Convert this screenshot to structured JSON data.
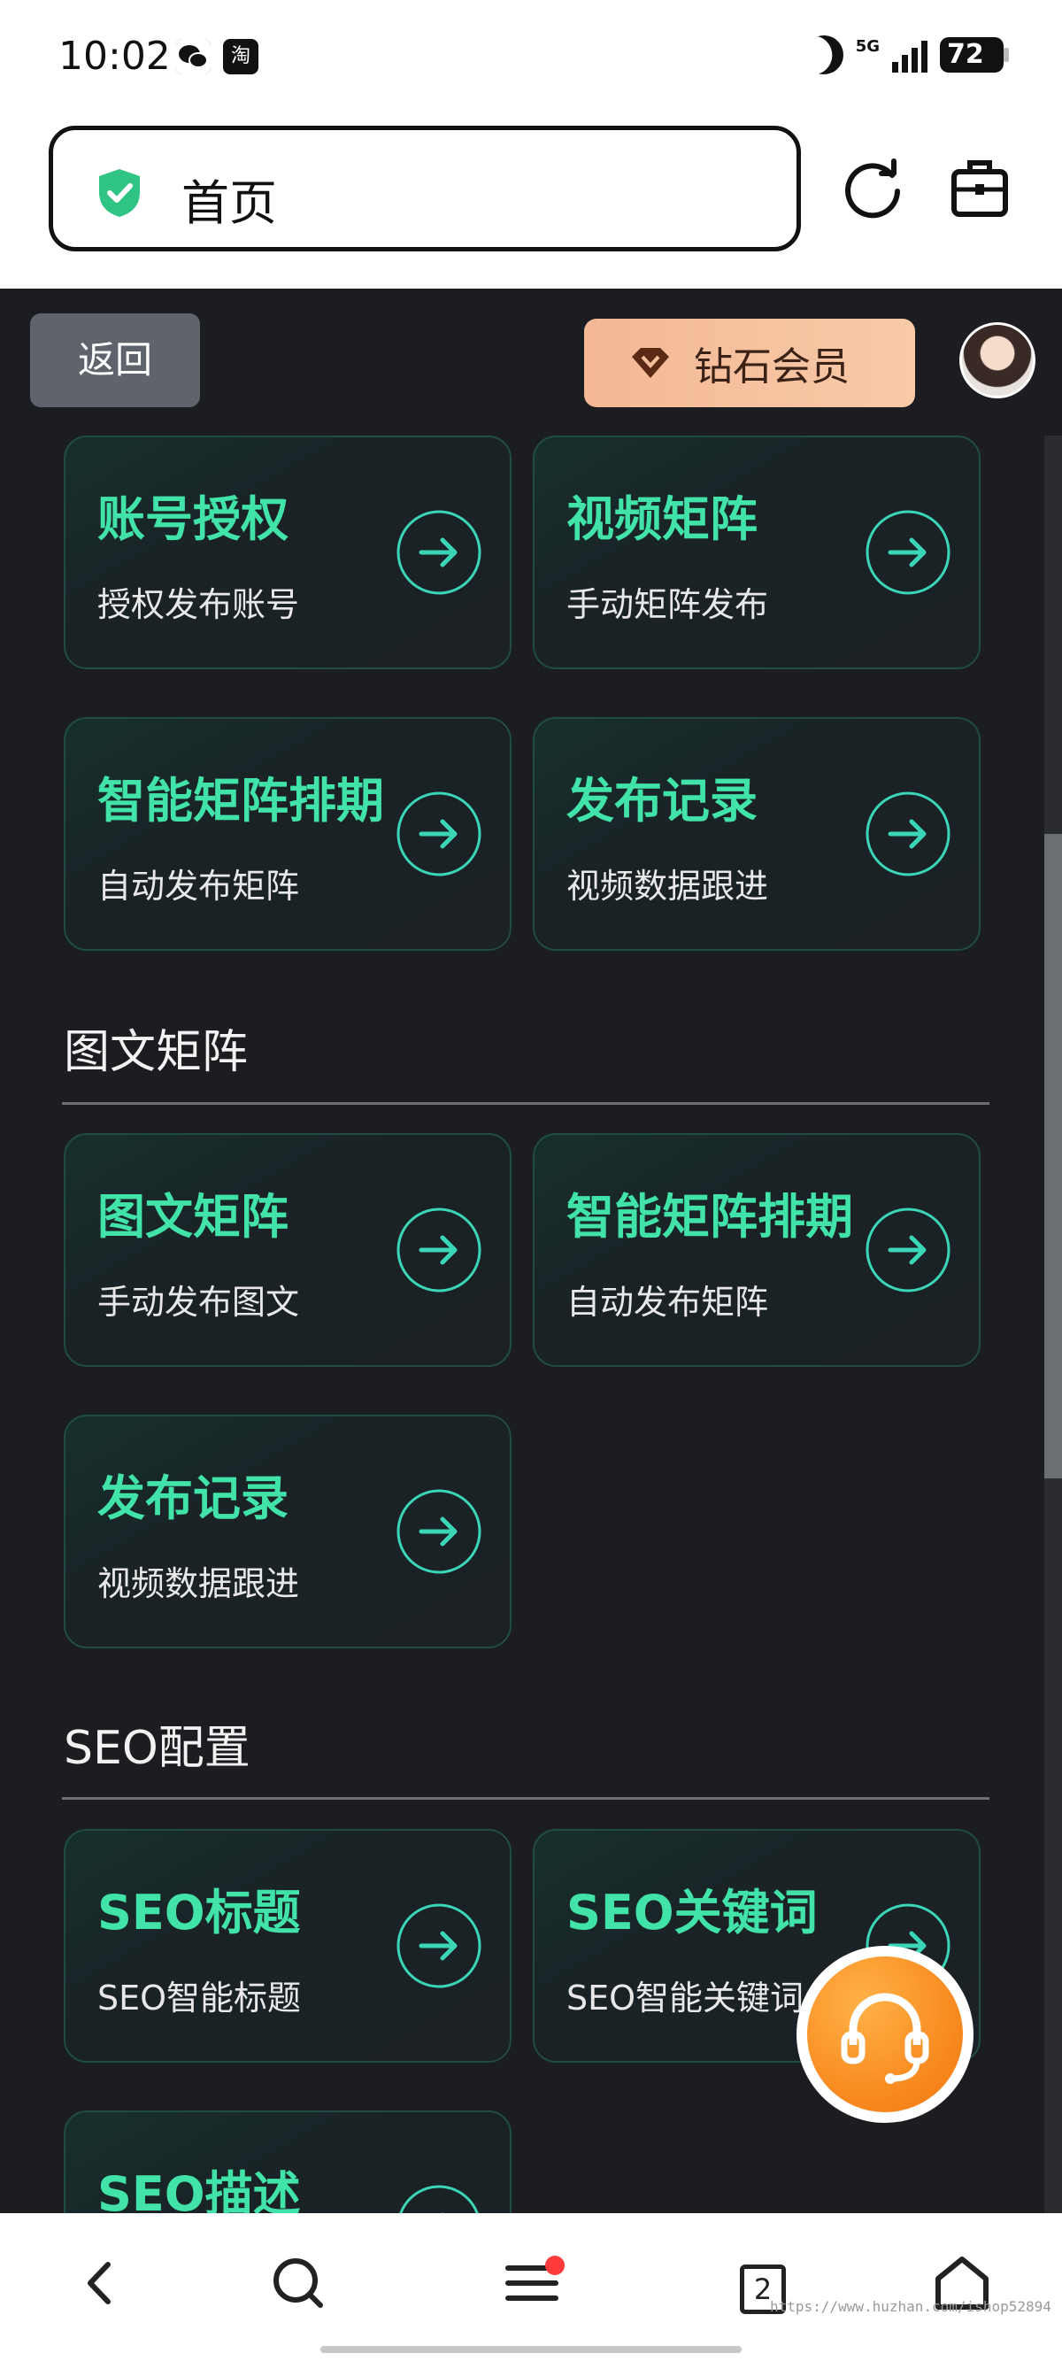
{
  "status_bar": {
    "time": "10:02",
    "app_icons": [
      "wechat-icon",
      "taobao-icon"
    ],
    "taobao_label": "淘",
    "network": "5G",
    "battery": "72"
  },
  "address_bar": {
    "title": "首页"
  },
  "header": {
    "back_label": "返回",
    "vip_label": "钻石会员"
  },
  "cards_top": [
    {
      "title": "账号授权",
      "subtitle": "授权发布账号"
    },
    {
      "title": "视频矩阵",
      "subtitle": "手动矩阵发布"
    },
    {
      "title": "智能矩阵排期",
      "subtitle": "自动发布矩阵"
    },
    {
      "title": "发布记录",
      "subtitle": "视频数据跟进"
    }
  ],
  "section_image_text": {
    "title": "图文矩阵",
    "cards": [
      {
        "title": "图文矩阵",
        "subtitle": "手动发布图文"
      },
      {
        "title": "智能矩阵排期",
        "subtitle": "自动发布矩阵"
      },
      {
        "title": "发布记录",
        "subtitle": "视频数据跟进"
      }
    ]
  },
  "section_seo": {
    "title": "SEO配置",
    "cards": [
      {
        "title": "SEO标题",
        "subtitle": "SEO智能标题"
      },
      {
        "title": "SEO关键词",
        "subtitle": "SEO智能关键词"
      },
      {
        "title": "SEO描述",
        "subtitle": ""
      }
    ]
  },
  "bottom_nav": {
    "tab_count": "2",
    "watermark": "https://www.huzhan.com/ishop52894"
  },
  "colors": {
    "accent": "#41e3a9",
    "background": "#1b1d21",
    "vip": "#f6bf9c",
    "support": "#f7861c"
  }
}
